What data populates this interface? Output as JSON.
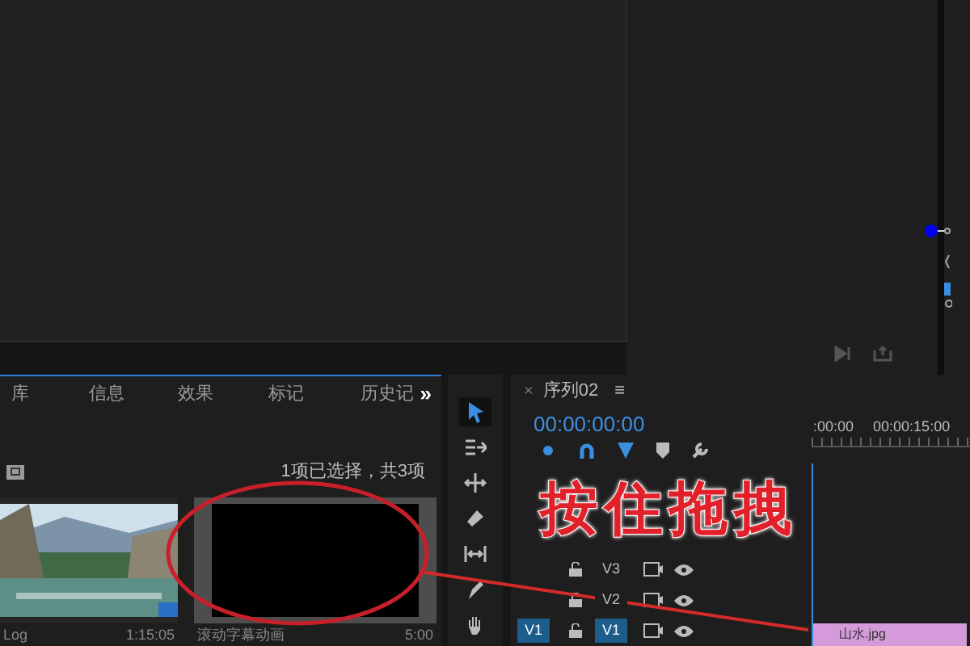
{
  "project_panel": {
    "tabs": [
      {
        "label": "库",
        "selected": false
      },
      {
        "label": "信息",
        "selected": false
      },
      {
        "label": "效果",
        "selected": false
      },
      {
        "label": "标记",
        "selected": false
      },
      {
        "label": "历史记",
        "selected": false
      }
    ],
    "overflow": "»",
    "selection_info": "1项已选择，共3项",
    "items": [
      {
        "kind": "picture",
        "name": "Log",
        "duration": "1:15:05",
        "selected": false
      },
      {
        "kind": "black",
        "name": "滚动字幕动画",
        "duration": "5:00",
        "selected": true
      }
    ]
  },
  "tools": [
    {
      "kind": "select",
      "selected": true
    },
    {
      "kind": "track",
      "selected": false
    },
    {
      "kind": "ripple",
      "selected": false
    },
    {
      "kind": "razor",
      "selected": false
    },
    {
      "kind": "slip",
      "selected": false
    },
    {
      "kind": "pen",
      "selected": false
    },
    {
      "kind": "hand",
      "selected": false
    }
  ],
  "timeline": {
    "close": "×",
    "title": "序列02",
    "menu": "≡",
    "timecode": "00:00:00:00",
    "ruler": [
      ":00:00",
      "00:00:15:00"
    ],
    "tracks": [
      {
        "label": "V3",
        "targeted": false
      },
      {
        "label": "V2",
        "targeted": false
      },
      {
        "label": "V1",
        "targeted": true,
        "source_label": "V1"
      }
    ],
    "clip": {
      "name": "山水.jpg"
    }
  },
  "annotation": {
    "text": "按住拖拽"
  }
}
